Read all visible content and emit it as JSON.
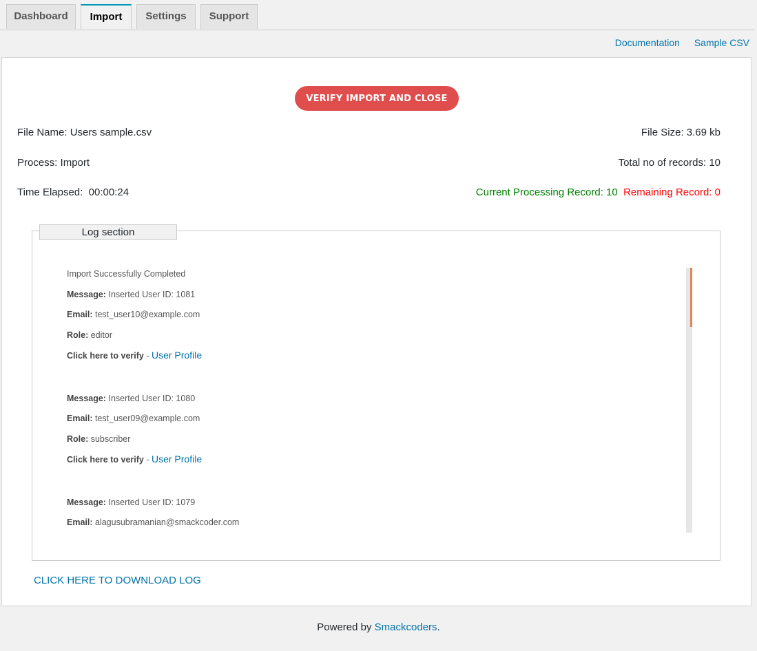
{
  "tabs": [
    {
      "label": "Dashboard",
      "active": false
    },
    {
      "label": "Import",
      "active": true
    },
    {
      "label": "Settings",
      "active": false
    },
    {
      "label": "Support",
      "active": false
    }
  ],
  "top_links": {
    "documentation": "Documentation",
    "sample_csv": "Sample CSV"
  },
  "actions": {
    "verify_button": "VERIFY IMPORT AND CLOSE",
    "download_log": "CLICK HERE TO DOWNLOAD LOG"
  },
  "summary": {
    "file_name_label": "File Name:",
    "file_name": "Users sample.csv",
    "file_size_label": "File Size:",
    "file_size": "3.69 kb",
    "process_label": "Process:",
    "process": "Import",
    "total_records_label": "Total no of records:",
    "total_records": "10",
    "time_elapsed_label": "Time Elapsed:",
    "time_elapsed": "00:00:24",
    "current_record_label": "Current Processing Record:",
    "current_record": "10",
    "remaining_record_label": "Remaining Record:",
    "remaining_record": "0"
  },
  "log": {
    "legend": "Log section",
    "status": "Import Successfully Completed",
    "labels": {
      "message": "Message:",
      "email": "Email:",
      "role": "Role:",
      "verify": "Click here to verify",
      "separator": " - ",
      "profile_link": "User Profile"
    },
    "entries": [
      {
        "message": "Inserted User ID: 1081",
        "email": "test_user10@example.com",
        "role": "editor"
      },
      {
        "message": "Inserted User ID: 1080",
        "email": "test_user09@example.com",
        "role": "subscriber"
      },
      {
        "message": "Inserted User ID: 1079",
        "email": "alagusubramanian@smackcoder.com"
      }
    ]
  },
  "footer": {
    "prefix": "Powered by",
    "link": "Smackcoders",
    "suffix": "."
  },
  "colors": {
    "accent_button": "#e04d4d",
    "link": "#0073aa",
    "success": "#008000",
    "error": "#ff0000",
    "scroll_thumb": "#e0845e"
  }
}
